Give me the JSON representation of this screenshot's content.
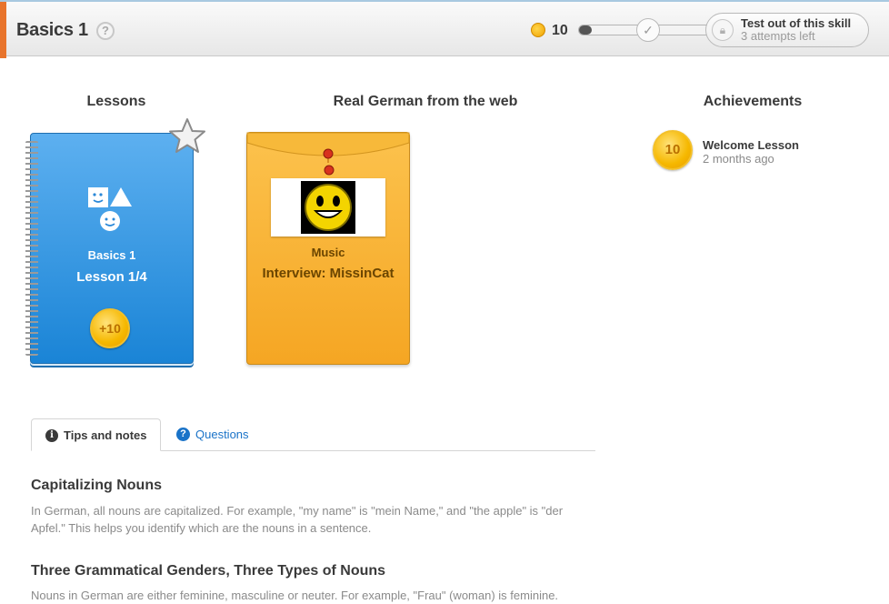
{
  "header": {
    "title": "Basics 1",
    "help_icon": "?",
    "coins": "10",
    "progress_fraction": 0.05,
    "test_out_title": "Test out of this skill",
    "test_out_sub": "3 attempts left"
  },
  "sections": {
    "lessons": "Lessons",
    "real": "Real German from the web",
    "achievements": "Achievements"
  },
  "lesson_card": {
    "subtitle": "Basics 1",
    "title": "Lesson 1/4",
    "reward": "+10"
  },
  "web_card": {
    "category": "Music",
    "title": "Interview: MissinCat"
  },
  "achievement": {
    "coin": "10",
    "name": "Welcome Lesson",
    "time": "2 months ago"
  },
  "tabs": {
    "tips": "Tips and notes",
    "questions": "Questions"
  },
  "notes": [
    {
      "heading": "Capitalizing Nouns",
      "text": "In German, all nouns are capitalized. For example, \"my name\" is \"mein Name,\" and \"the apple\" is \"der Apfel.\" This helps you identify which are the nouns in a sentence."
    },
    {
      "heading": "Three Grammatical Genders, Three Types of Nouns",
      "text": "Nouns in German are either feminine, masculine or neuter. For example, \"Frau\" (woman) is feminine."
    }
  ],
  "colors": {
    "accent": "#e8742c",
    "link": "#1a73c8",
    "notebook": "#1a84d6",
    "envelope": "#f5a623",
    "coin": "#f6b800"
  }
}
